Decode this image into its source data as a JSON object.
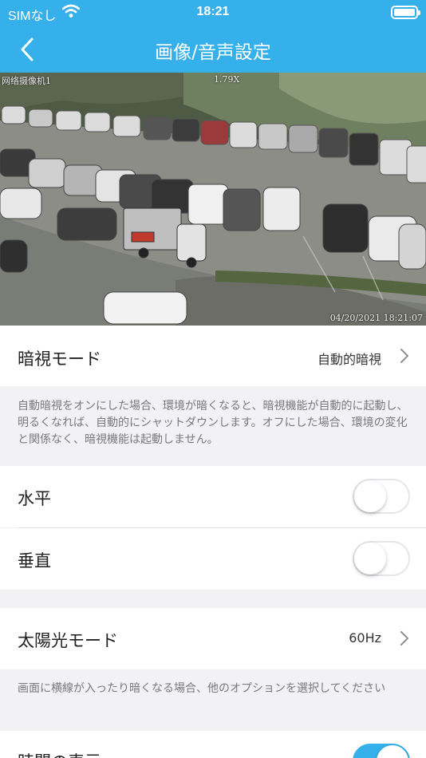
{
  "status_bar": {
    "carrier": "SIMなし",
    "time": "18:21"
  },
  "nav": {
    "title": "画像/音声設定"
  },
  "video": {
    "camera_name": "网络摄像机1",
    "zoom": "1.79X",
    "timestamp": "04/20/2021 18:21:07"
  },
  "settings": {
    "night_vision": {
      "label": "暗視モード",
      "value": "自動的暗視",
      "note": "自動暗視をオンにした場合、環境が暗くなると、暗視機能が自動的に起動し、明るくなれば、自動的にシャットダウンします。オフにした場合、環境の変化と関係なく、暗視機能は起動しません。"
    },
    "horizontal": {
      "label": "水平",
      "on": false
    },
    "vertical": {
      "label": "垂直",
      "on": false
    },
    "sunlight_mode": {
      "label": "太陽光モード",
      "value": "60Hz",
      "note": "画面に横線が入ったり暗くなる場合、他のオプションを選択してください"
    },
    "time_display": {
      "label": "時間の表示",
      "on": true
    }
  },
  "colors": {
    "accent": "#36b0ea",
    "background": "#f2f2f4",
    "note_text": "#7a7a7e"
  }
}
